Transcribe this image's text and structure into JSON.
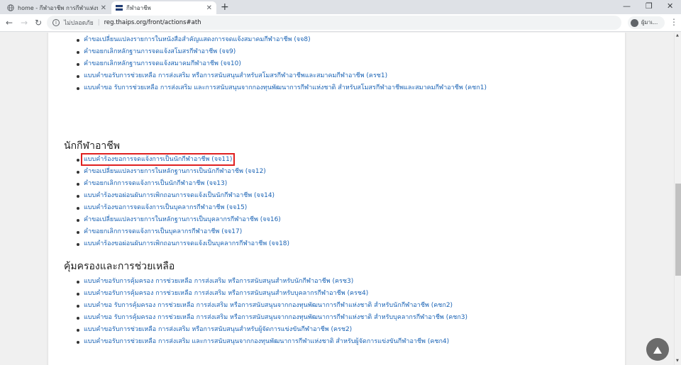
{
  "browser": {
    "tabs": [
      {
        "title": "home - กีฬาอาชีพ การกีฬาแห่งประเทศไทย",
        "favicon": "globe-icon",
        "active": false
      },
      {
        "title": "กีฬาอาชีพ",
        "favicon": "site-logo-icon",
        "active": true
      }
    ],
    "new_tab": "+",
    "window": {
      "minimize": "—",
      "restore": "❐",
      "close": "✕"
    },
    "nav": {
      "back": "←",
      "forward": "→",
      "reload": "↻"
    },
    "security_icon": "i",
    "security_text": "ไม่ปลอดภัย",
    "url": "reg.thaips.org/front/actions#ath",
    "profile_label": "ผู้มาเ...",
    "menu": "⋮"
  },
  "sections": {
    "club_list": [
      "คำขอเปลี่ยนแปลงรายการในหนังสือสำคัญแสดงการจดแจ้งสมาคมกีฬาอาชีพ (จจ8)",
      "คำขอยกเลิกหลักฐานการจดแจ้งสโมสรกีฬาอาชีพ (จจ9)",
      "คำขอยกเลิกหลักฐานการจดแจ้งสมาคมกีฬาอาชีพ (จจ10)",
      "แบบคำขอรับการช่วยเหลือ การส่งเสริม หรือการสนับสนุนสำหรับสโมสรกีฬาอาชีพและสมาคมกีฬาอาชีพ (ครช1)",
      "แบบคำขอ รับการช่วยเหลือ การส่งเสริม และการสนับสนุนจากกองทุนพัฒนาการกีฬาแห่งชาติ สำหรับสโมสรกีฬาอาชีพและสมาคมกีฬาอาชีพ (คชก1)"
    ],
    "athlete_title": "นักกีฬาอาชีพ",
    "athlete_list": [
      "แบบคำร้องขอการจดแจ้งการเป็นนักกีฬาอาชีพ (จจ11)",
      "คำขอเปลี่ยนแปลงรายการในหลักฐานการเป็นนักกีฬาอาชีพ (จจ12)",
      "คำขอยกเลิกการจดแจ้งการเป็นนักกีฬาอาชีพ (จจ13)",
      "แบบคำร้องขอผ่อนผันการเพิกถอนการจดแจ้งเป็นนักกีฬาอาชีพ (จจ14)",
      "แบบคำร้องขอการจดแจ้งการเป็นบุคลากรกีฬาอาชีพ (จจ15)",
      "คำขอเปลี่ยนแปลงรายการในหลักฐานการเป็นบุคลากรกีฬาอาชีพ (จจ16)",
      "คำขอยกเลิกการจดแจ้งการเป็นบุคลากรกีฬาอาชีพ (จจ17)",
      "แบบคำร้องขอผ่อนผันการเพิกถอนการจดแจ้งเป็นบุคลากรกีฬาอาชีพ (จจ18)"
    ],
    "protection_title": "คุ้มครองและการช่วยเหลือ",
    "protection_list": [
      "แบบคำขอรับการคุ้มครอง การช่วยเหลือ การส่งเสริม หรือการสนับสนุนสำหรับนักกีฬาอาชีพ (ครช3)",
      "แบบคำขอรับการคุ้มครอง การช่วยเหลือ การส่งเสริม หรือการสนับสนุนสำหรับบุคลากรกีฬาอาชีพ (ครช4)",
      "แบบคำขอ รับการคุ้มครอง การช่วยเหลือ การส่งเสริม หรือการสนับสนุนจากกองทุนพัฒนาการกีฬาแห่งชาติ สำหรับนักกีฬาอาชีพ (คชก2)",
      "แบบคำขอ รับการคุ้มครอง การช่วยเหลือ การส่งเสริม หรือการสนับสนุนจากกองทุนพัฒนาการกีฬาแห่งชาติ สำหรับบุคลากรกีฬาอาชีพ (คชก3)",
      "แบบคำขอรับการช่วยเหลือ การส่งเสริม หรือการสนับสนุนสำหรับผู้จัดการแข่งขันกีฬาอาชีพ (ครช2)",
      "แบบคำขอรับการช่วยเหลือ การส่งเสริม และการสนับสนุนจากกองทุนพัฒนาการกีฬาแห่งชาติ สำหรับผู้จัดการแข่งขันกีฬาอาชีพ (คชก4)"
    ]
  },
  "back_to_top_icon": "arrow-up-icon",
  "colors": {
    "link": "#1a63b5",
    "highlight": "#e02020",
    "tab_bg": "#dee1e6"
  }
}
